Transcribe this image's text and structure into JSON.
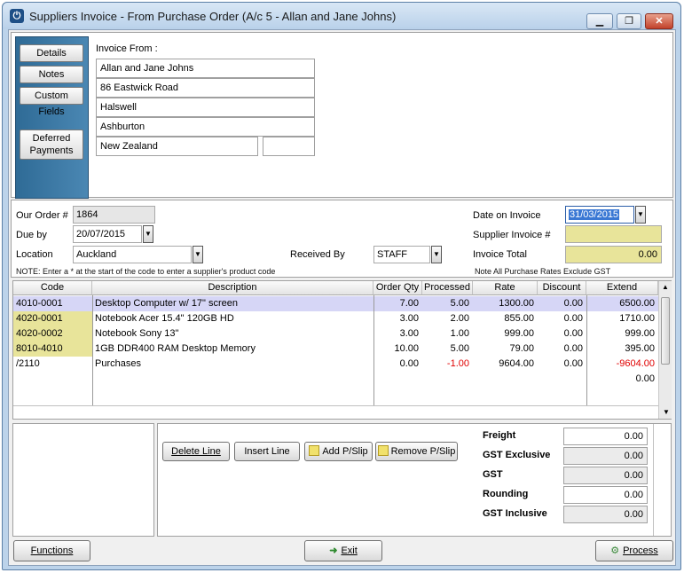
{
  "window": {
    "title": "Suppliers Invoice - From Purchase Order (A/c 5 - Allan and Jane Johns)",
    "min_icon": "minimize-icon",
    "restore_icon": "restore-icon",
    "close_icon": "close-icon"
  },
  "sidebar": {
    "details": "Details",
    "notes": "Notes",
    "custom_fields": "Custom Fields",
    "deferred_1": "Deferred",
    "deferred_2": "Payments"
  },
  "invoice_from": {
    "label": "Invoice From  :",
    "lines": [
      "Allan and Jane Johns",
      "86 Eastwick Road",
      "Halswell",
      "Ashburton",
      "New Zealand"
    ],
    "postcode": ""
  },
  "order": {
    "our_order_label": "Our Order #",
    "our_order_value": "1864",
    "due_by_label": "Due by",
    "due_by_value": "20/07/2015",
    "location_label": "Location",
    "location_value": "Auckland",
    "received_by_label": "Received By",
    "received_by_value": "STAFF",
    "note": "NOTE: Enter a * at the start of the code to enter a supplier's product code",
    "date_on_invoice_label": "Date on Invoice",
    "date_on_invoice_value": "31/03/2015",
    "supplier_invoice_label": "Supplier Invoice #",
    "supplier_invoice_value": "",
    "invoice_total_label": "Invoice Total",
    "invoice_total_value": "0.00",
    "gst_note": "Note All Purchase Rates Exclude GST"
  },
  "grid": {
    "columns": [
      "Code",
      "Description",
      "Order Qty",
      "Processed",
      "Rate",
      "Discount",
      "Extend"
    ],
    "rows": [
      {
        "code": "4010-0001",
        "description": "Desktop Computer w/ 17\" screen",
        "order_qty": "7.00",
        "processed": "5.00",
        "rate": "1300.00",
        "discount": "0.00",
        "extend": "6500.00"
      },
      {
        "code": "4020-0001",
        "description": "Notebook Acer 15.4\" 120GB HD",
        "order_qty": "3.00",
        "processed": "2.00",
        "rate": "855.00",
        "discount": "0.00",
        "extend": "1710.00"
      },
      {
        "code": "4020-0002",
        "description": "Notebook Sony 13\"",
        "order_qty": "3.00",
        "processed": "1.00",
        "rate": "999.00",
        "discount": "0.00",
        "extend": "999.00"
      },
      {
        "code": "8010-4010",
        "description": "1GB DDR400 RAM Desktop Memory",
        "order_qty": "10.00",
        "processed": "5.00",
        "rate": "79.00",
        "discount": "0.00",
        "extend": "395.00"
      },
      {
        "code": "/2110",
        "description": "Purchases",
        "order_qty": "0.00",
        "processed": "-1.00",
        "rate": "9604.00",
        "discount": "0.00",
        "extend": "-9604.00"
      }
    ],
    "total_extend": "0.00"
  },
  "actions": {
    "delete_line": "Delete Line",
    "insert_line": "Insert Line",
    "add_pslip": "Add P/Slip",
    "remove_pslip": "Remove P/Slip"
  },
  "totals": {
    "freight_label": "Freight",
    "freight": "0.00",
    "gst_exclusive_label": "GST Exclusive",
    "gst_exclusive": "0.00",
    "gst_label": "GST",
    "gst": "0.00",
    "rounding_label": "Rounding",
    "rounding": "0.00",
    "gst_inclusive_label": "GST Inclusive",
    "gst_inclusive": "0.00"
  },
  "footer": {
    "functions": "Functions",
    "exit": "Exit",
    "process": "Process"
  }
}
